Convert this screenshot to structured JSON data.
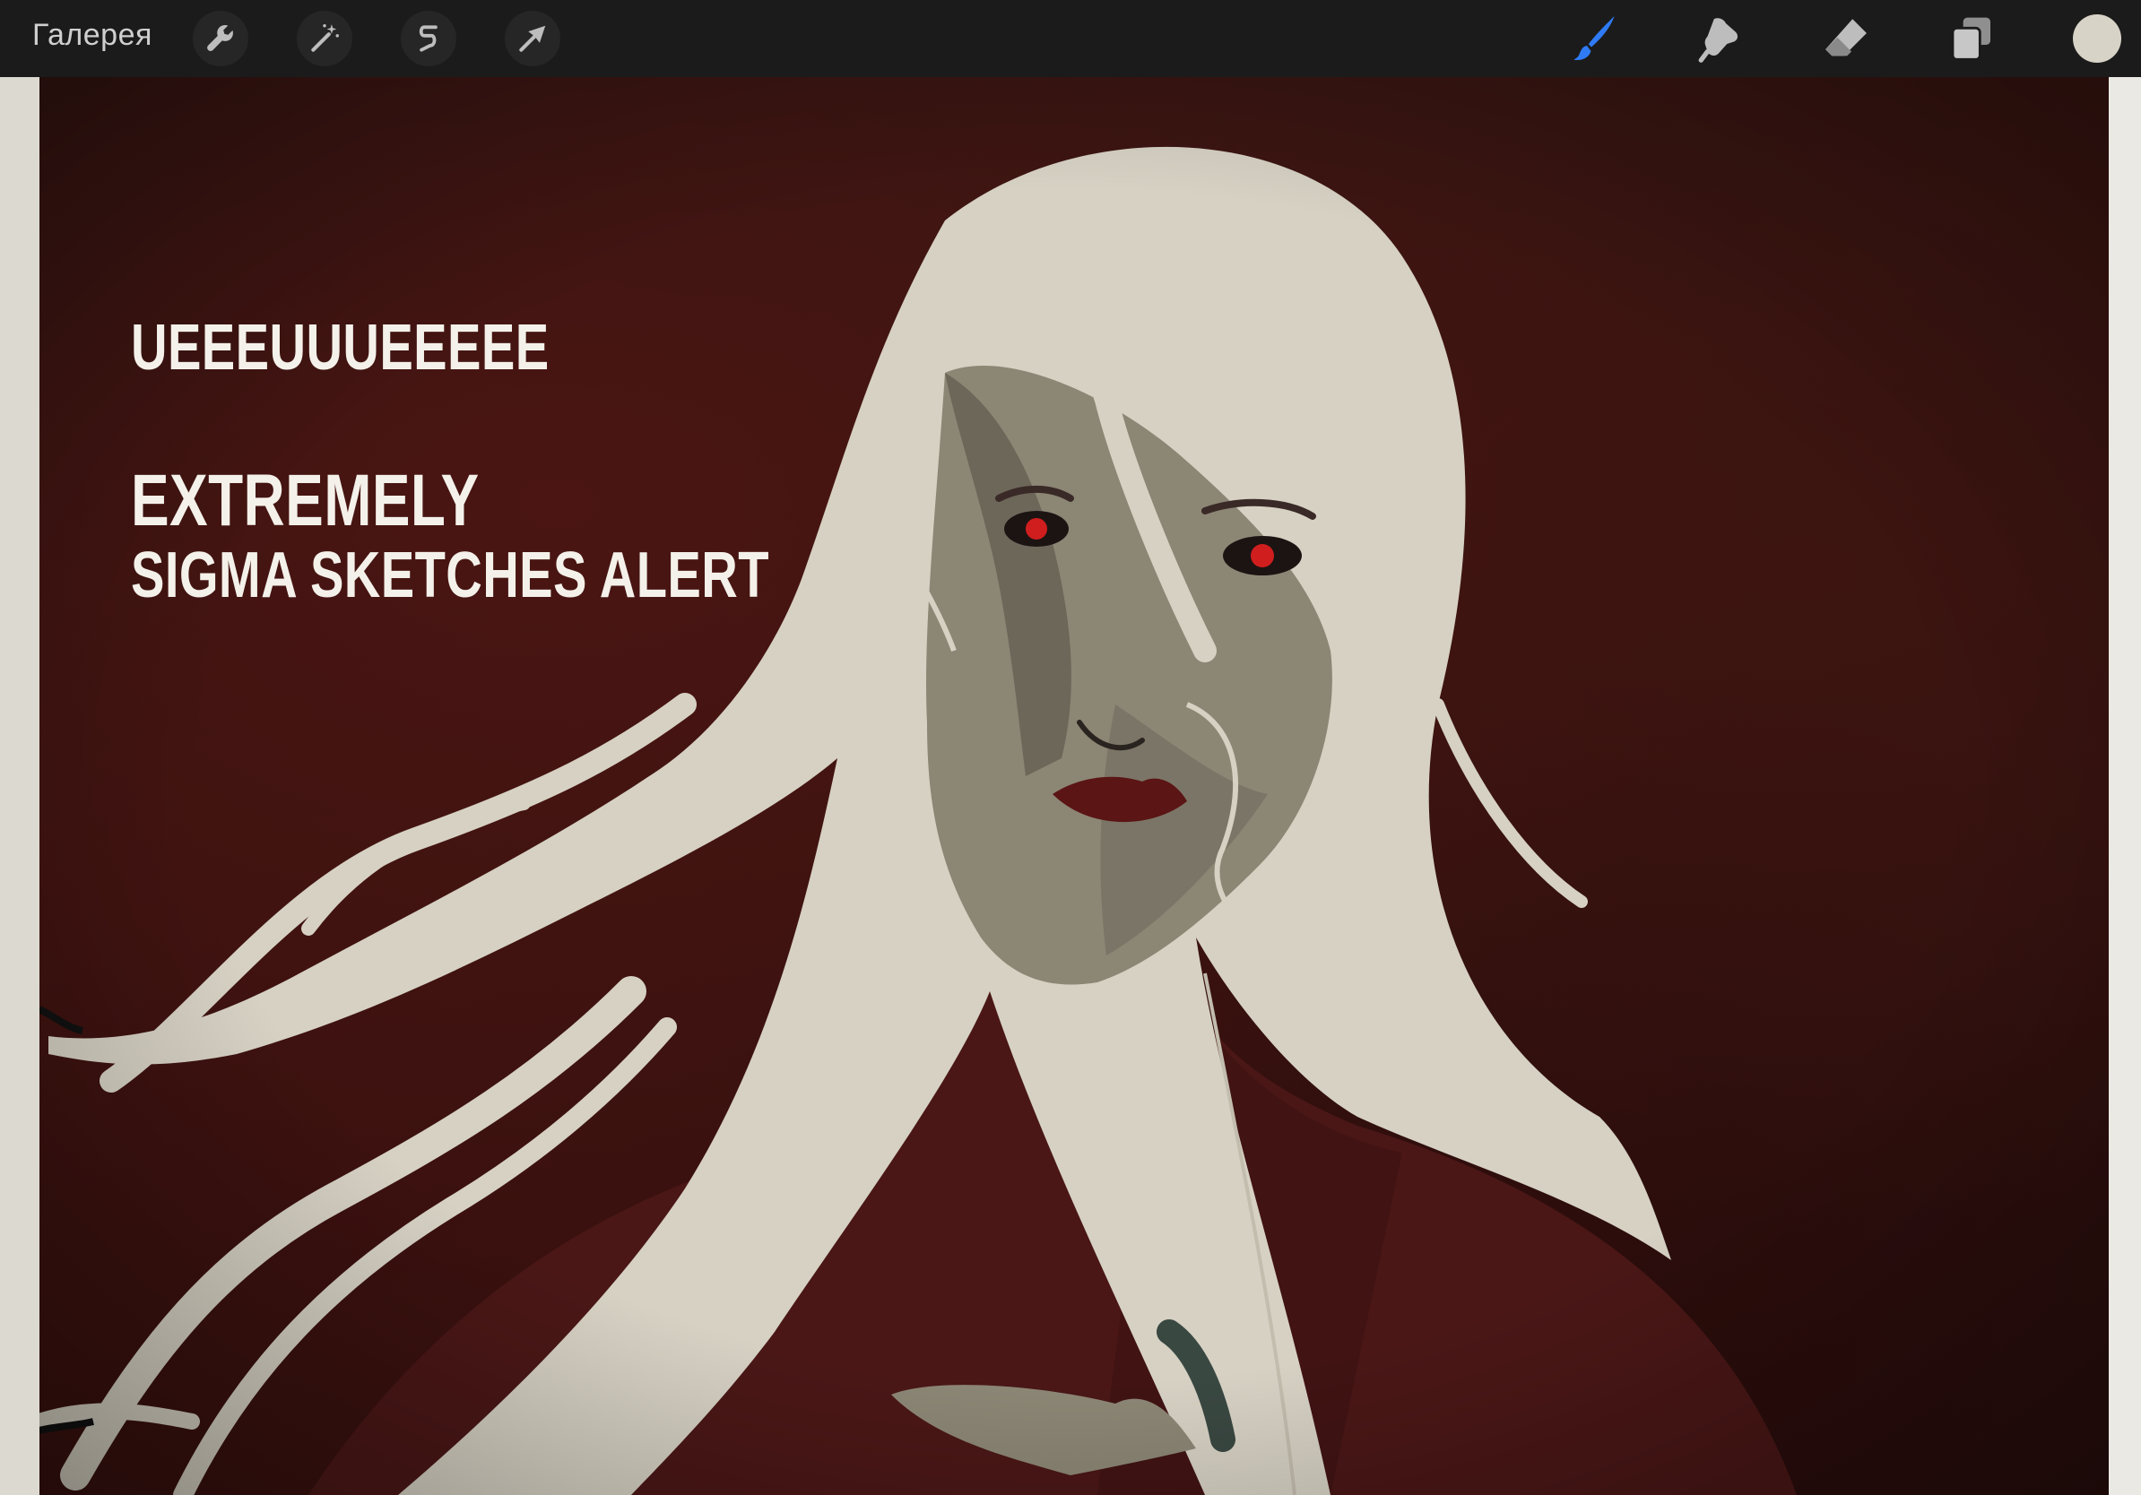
{
  "toolbar": {
    "gallery_label": "Галерея",
    "left_tools": [
      {
        "name": "actions",
        "icon": "wrench-icon"
      },
      {
        "name": "adjustments",
        "icon": "magic-wand-icon"
      },
      {
        "name": "selection",
        "icon": "selection-s-icon"
      },
      {
        "name": "transform",
        "icon": "arrow-cursor-icon"
      }
    ],
    "right_tools": [
      {
        "name": "brush",
        "icon": "brush-icon",
        "active": true
      },
      {
        "name": "smudge",
        "icon": "smudge-finger-icon"
      },
      {
        "name": "eraser",
        "icon": "eraser-icon"
      },
      {
        "name": "layers",
        "icon": "layers-icon"
      }
    ],
    "current_color": "#d8d3c7",
    "active_color": "#2f7bf5"
  },
  "canvas": {
    "text_lines": [
      "UEEEUUUEEEEE",
      "EXTREMELY",
      "SIGMA SKETCHES ALERT"
    ],
    "background_color": "#3a1511",
    "hair_color": "#d6d1c3",
    "skin_color": "#8c8675",
    "dress_color": "#4a1716",
    "eye_color": "#d01e1e"
  }
}
